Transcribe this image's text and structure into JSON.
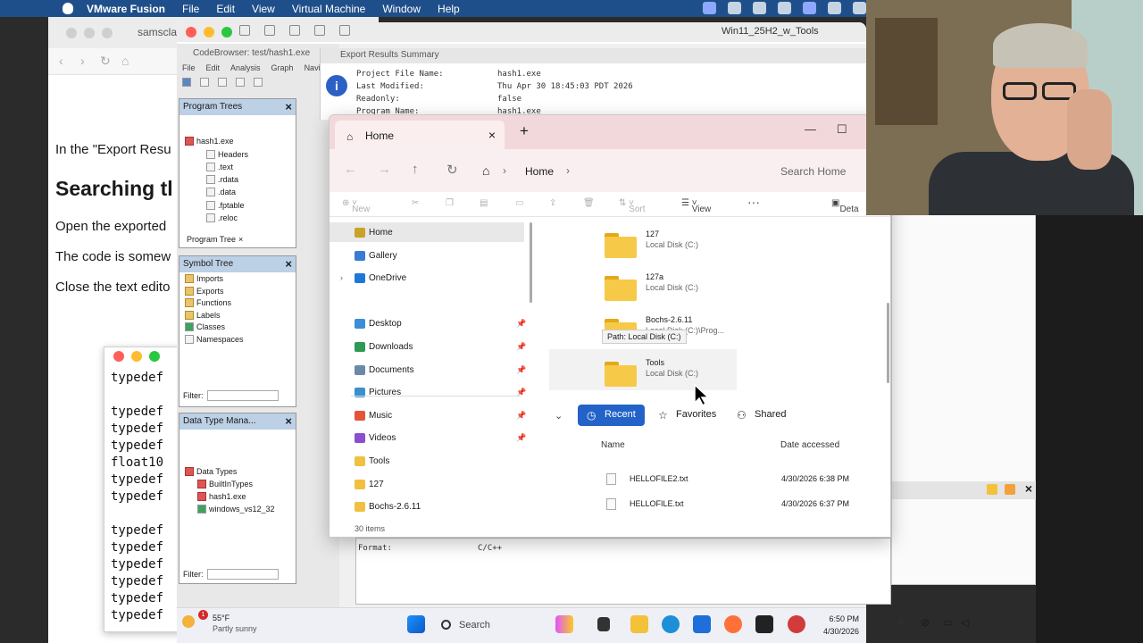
{
  "mac_menubar": {
    "app_name": "VMware Fusion",
    "menus": [
      "File",
      "Edit",
      "View",
      "Virtual Machine",
      "Window",
      "Help"
    ]
  },
  "browser": {
    "tab_title": "samsclass",
    "paragraphs": {
      "export_results": "In the \"Export Resu",
      "heading": "Searching tl",
      "open_exported": "Open the exported",
      "code_somewhat": "The code is somew",
      "close_editor": "Close the text edito"
    }
  },
  "code_window": {
    "lines": [
      "typedef",
      "",
      "typedef",
      "typedef",
      "typedef",
      "float10",
      "typedef",
      "typedef",
      "",
      "typedef",
      "typedef",
      "typedef",
      "typedef",
      "typedef",
      "typedef"
    ]
  },
  "vm_window": {
    "title": "Win11_25H2_w_Tools"
  },
  "ghidra": {
    "codebrowser_title": "CodeBrowser: test/hash1.exe",
    "menus": [
      "File",
      "Edit",
      "Analysis",
      "Graph",
      "Navig"
    ],
    "program_trees": {
      "title": "Program Trees",
      "root": "hash1.exe",
      "sections": [
        "Headers",
        ".text",
        ".rdata",
        ".data",
        ".fptable",
        ".reloc"
      ],
      "footer_tab": "Program Tree"
    },
    "symbol_tree": {
      "title": "Symbol Tree",
      "nodes": [
        "Imports",
        "Exports",
        "Functions",
        "Labels",
        "Classes",
        "Namespaces"
      ],
      "filter_label": "Filter:"
    },
    "data_type_manager": {
      "title": "Data Type Mana...",
      "root": "Data Types",
      "nodes": [
        "BuiltInTypes",
        "hash1.exe",
        "windows_vs12_32"
      ],
      "filter_label": "Filter:"
    },
    "export_summary": {
      "title": "Export Results Summary",
      "lines": [
        {
          "key": "Project File Name:",
          "value": "hash1.exe"
        },
        {
          "key": "Last Modified:",
          "value": "Thu Apr 30 18:45:03 PDT 2026"
        },
        {
          "key": "Readonly:",
          "value": "false"
        },
        {
          "key": "Program Name:",
          "value": "hash1.exe"
        }
      ],
      "format_key": "Format:",
      "format_value": "C/C++"
    }
  },
  "explorer": {
    "tab_title": "Home",
    "breadcrumb": "Home",
    "search_placeholder": "Search Home",
    "commands": {
      "new": "New",
      "sort": "Sort",
      "view": "View",
      "details": "Deta"
    },
    "nav": [
      {
        "label": "Home",
        "color": "#c9a227",
        "pinned": false,
        "selected": true
      },
      {
        "label": "Gallery",
        "color": "#3a7bd5",
        "pinned": false
      },
      {
        "label": "OneDrive",
        "color": "#1e78d7",
        "pinned": false,
        "expandable": true
      },
      {
        "label": "Desktop",
        "color": "#3b8fd9",
        "pinned": true
      },
      {
        "label": "Downloads",
        "color": "#2e9a55",
        "pinned": true
      },
      {
        "label": "Documents",
        "color": "#6c89a8",
        "pinned": true
      },
      {
        "label": "Pictures",
        "color": "#3a8fd0",
        "pinned": true
      },
      {
        "label": "Music",
        "color": "#e4543a",
        "pinned": true
      },
      {
        "label": "Videos",
        "color": "#8a4fcf",
        "pinned": true
      },
      {
        "label": "Tools",
        "color": "#f1c040",
        "pinned": false
      },
      {
        "label": "127",
        "color": "#f1c040",
        "pinned": false
      },
      {
        "label": "Bochs-2.6.11",
        "color": "#f1c040",
        "pinned": false
      }
    ],
    "quick_access": [
      {
        "name": "127",
        "location": "Local Disk (C:)"
      },
      {
        "name": "127a",
        "location": "Local Disk (C:)"
      },
      {
        "name": "Bochs-2.6.11",
        "location": "Local Disk (C:)\\Prog..."
      },
      {
        "name": "Tools",
        "location": "Local Disk (C:)"
      }
    ],
    "tooltip": "Path: Local Disk (C:)",
    "recent_tabs": [
      "Recent",
      "Favorites",
      "Shared"
    ],
    "columns": {
      "name": "Name",
      "date": "Date accessed"
    },
    "files": [
      {
        "name": "HELLOFILE2.txt",
        "date": "4/30/2026 6:38 PM"
      },
      {
        "name": "HELLOFILE.txt",
        "date": "4/30/2026 6:37 PM"
      }
    ],
    "status": "30 items"
  },
  "taskbar": {
    "temperature": "55°F",
    "weather": "Partly sunny",
    "badge_count": "1",
    "search_label": "Search",
    "time": "6:50 PM",
    "date": "4/30/2026"
  },
  "colors": {
    "accent": "#2363c8",
    "explorer_tab_strip": "#f3d8db",
    "folder": "#f7c948"
  }
}
